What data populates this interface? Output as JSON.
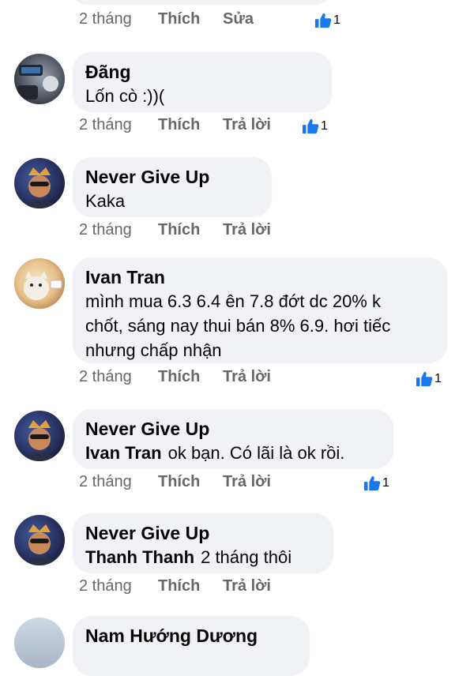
{
  "colors": {
    "bubble_bg": "#f0f2f5",
    "meta_text": "#65676b",
    "like_blue": "#1877f2"
  },
  "top_meta": {
    "time": "2 tháng",
    "like": "Thích",
    "action": "Sửa",
    "reaction_count": "1"
  },
  "comments": [
    {
      "author": "Đãng",
      "text": "Lốn cò :))(",
      "time": "2 tháng",
      "like": "Thích",
      "reply": "Trả lời",
      "reaction_count": "1"
    },
    {
      "author": "Never Give Up",
      "text": "Kaka",
      "time": "2 tháng",
      "like": "Thích",
      "reply": "Trả lời"
    },
    {
      "author": "Ivan Tran",
      "lines": [
        "mình mua 6.3 6.4 ên 7.8 đớt dc 20% k",
        "chốt, sáng nay thui bán 8% 6.9. hơi tiếc",
        "nhưng chấp nhận"
      ],
      "time": "2 tháng",
      "like": "Thích",
      "reply": "Trả lời",
      "reaction_count": "1"
    },
    {
      "author": "Never Give Up",
      "mention": "Ivan Tran",
      "text": "ok bạn. Có lãi là ok rồi.",
      "time": "2 tháng",
      "like": "Thích",
      "reply": "Trả lời",
      "reaction_count": "1"
    },
    {
      "author": "Never Give Up",
      "mention": "Thanh Thanh",
      "text": "2 tháng thôi",
      "time": "2 tháng",
      "like": "Thích",
      "reply": "Trả lời"
    },
    {
      "author": "Nam Hướng Dương"
    }
  ]
}
